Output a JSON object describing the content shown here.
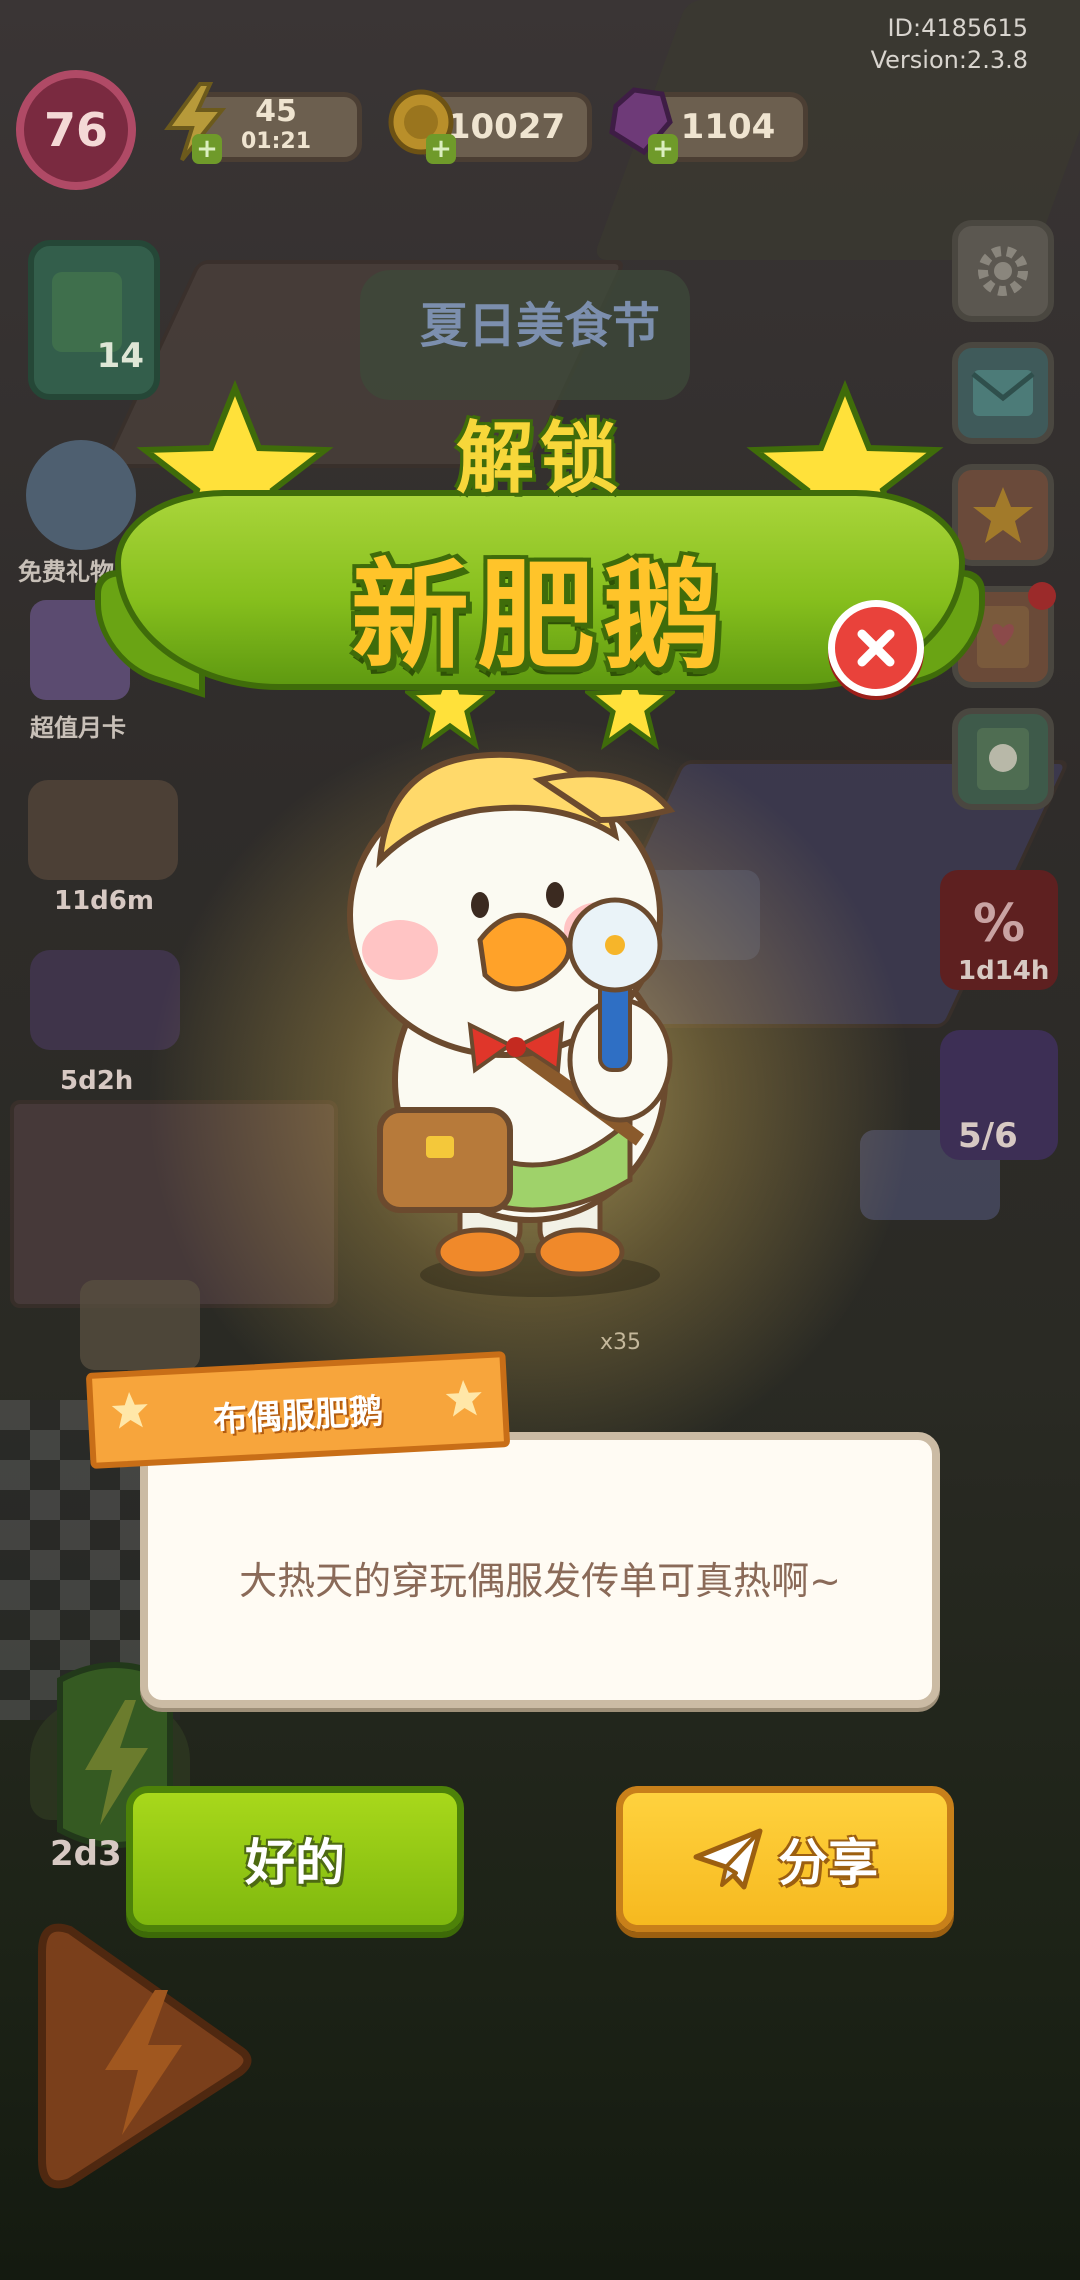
{
  "meta": {
    "id_text": "ID:4185615",
    "version_text": "Version:2.3.8"
  },
  "hud": {
    "level": "76",
    "energy": "45",
    "energy_timer": "01:21",
    "coins": "10027",
    "gems": "1104"
  },
  "left_side": {
    "board_count": "14",
    "free_gift": "免费礼物",
    "monthly_card": "超值月卡",
    "timer_1": "11d6m",
    "timer_2": "5d2h",
    "timer_3": "2d3"
  },
  "right_side": {
    "sale_timer": "1d14h",
    "jar_progress": "5/6"
  },
  "banner": {
    "subtitle": "解锁",
    "title": "新肥鹅",
    "event_sign": "夏日美食节"
  },
  "misc": {
    "count_label": "x35"
  },
  "character": {
    "name": "布偶服肥鹅",
    "quote": "大热天的穿玩偶服发传单可真热啊~"
  },
  "buttons": {
    "ok": "好的",
    "share": "分享"
  },
  "colors": {
    "accent_green": "#86bf1d",
    "accent_yellow": "#ffc42a",
    "close_red": "#e9423b",
    "tag_orange": "#f7a53c"
  }
}
